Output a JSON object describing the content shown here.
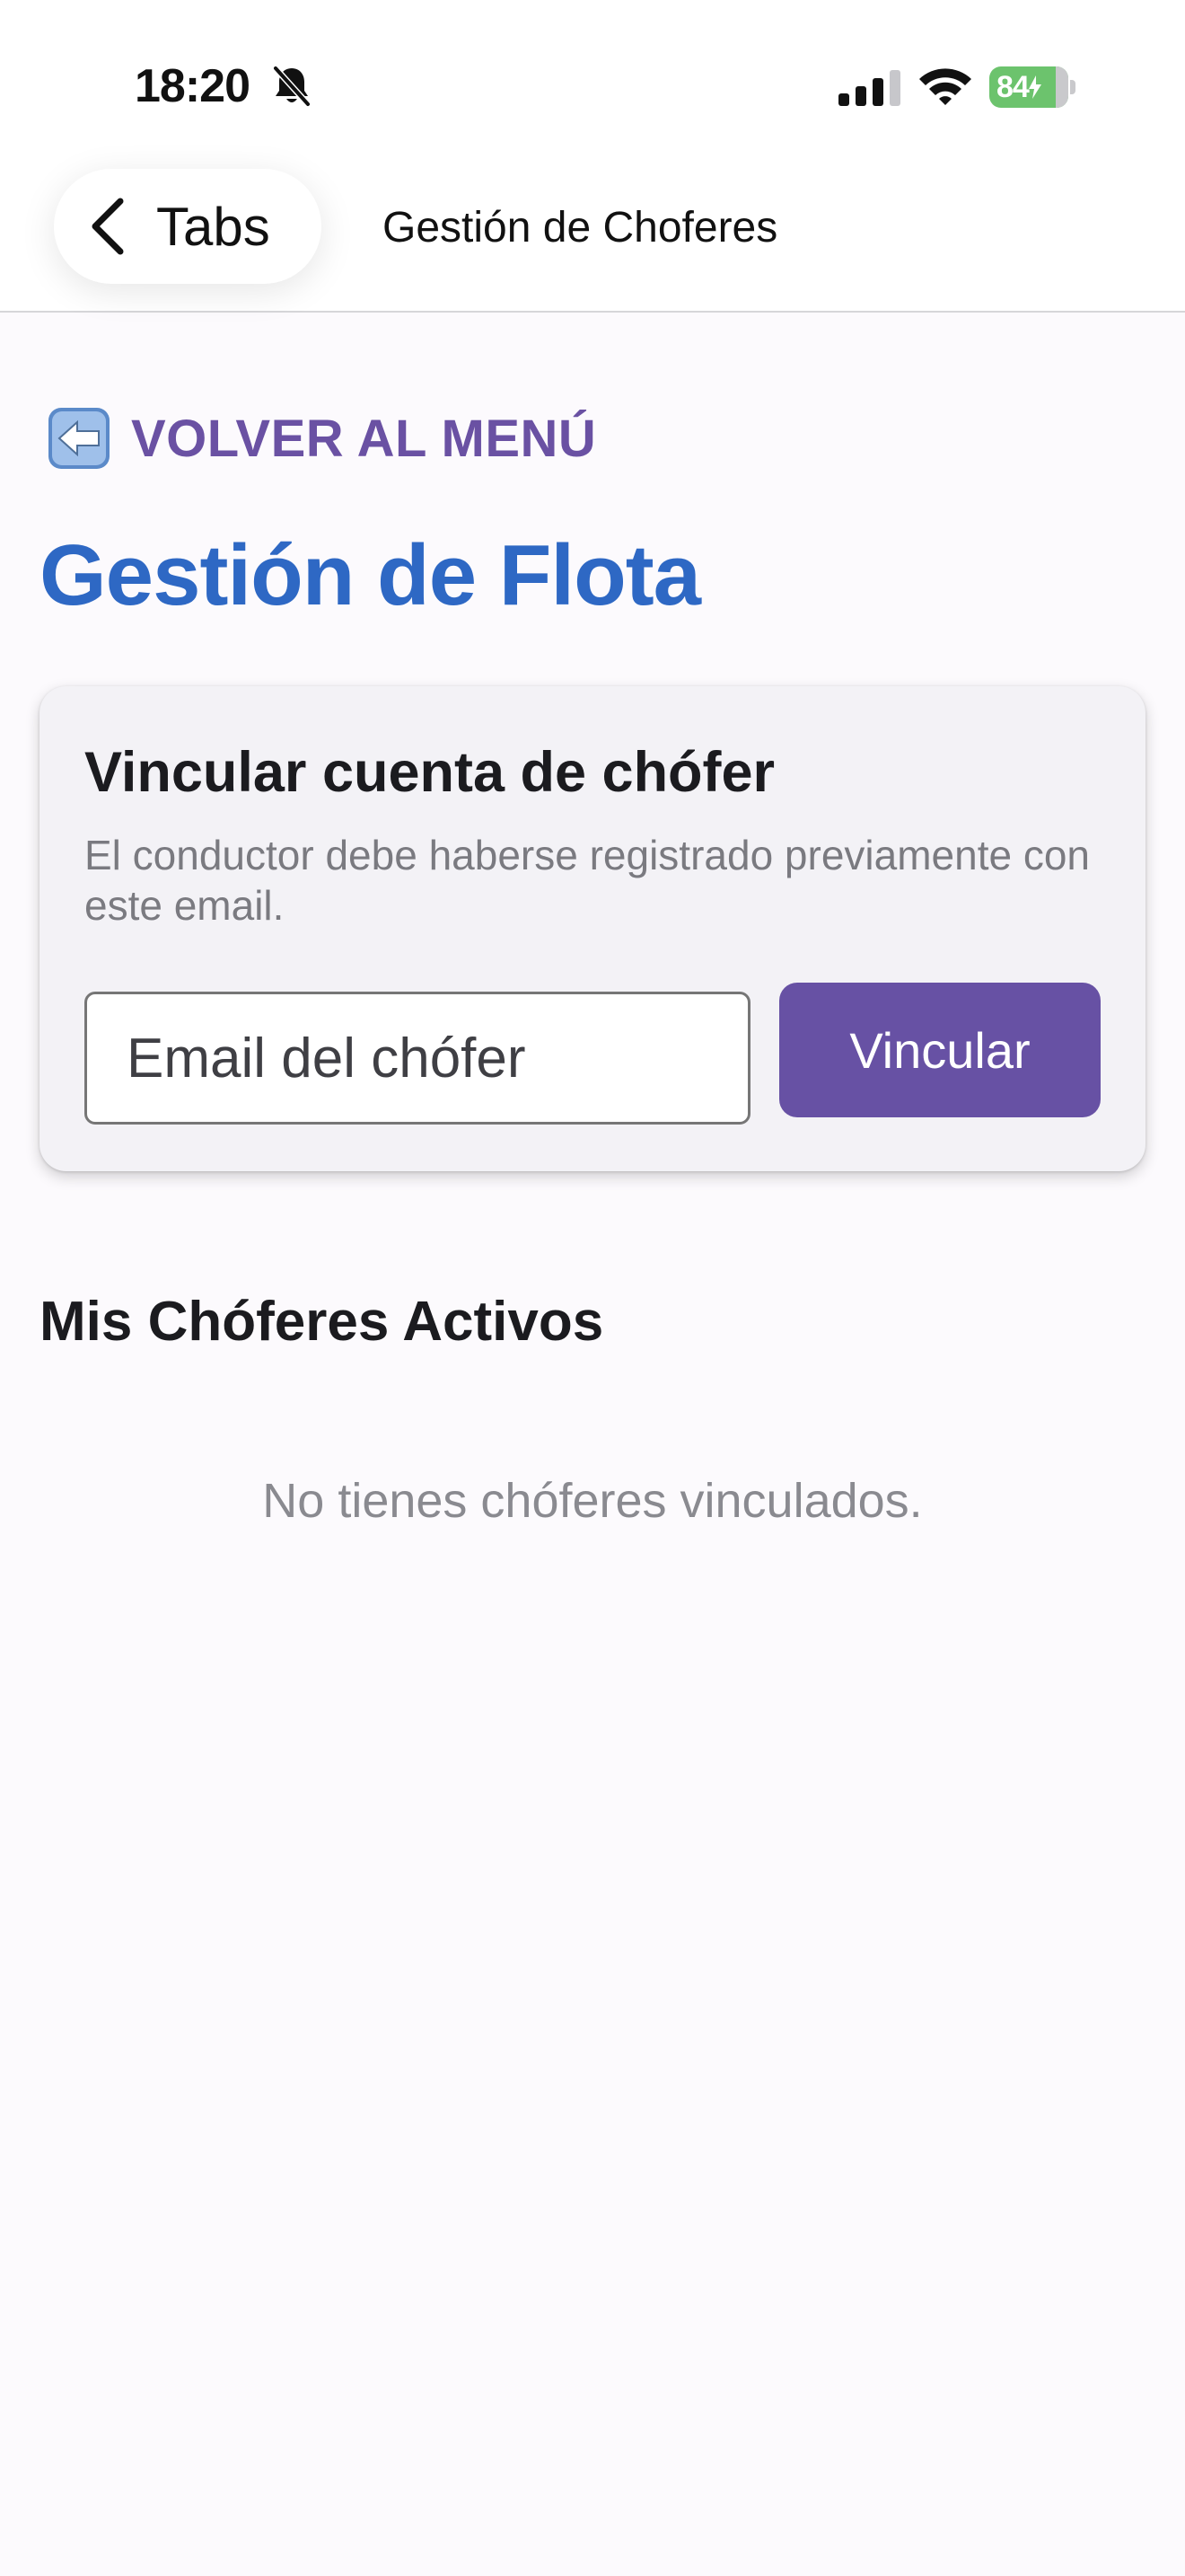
{
  "status_bar": {
    "time": "18:20",
    "battery_level": "84",
    "battery_color": "#6cc36d",
    "icons": [
      "bell-slash-icon",
      "signal-icon",
      "wifi-icon",
      "battery-charging-icon"
    ]
  },
  "nav": {
    "back_label": "Tabs",
    "back_icon": "chevron-left-icon",
    "title": "Gestión de Choferes"
  },
  "content": {
    "back_link_icon": "left-arrow-emoji-icon",
    "back_link_label": "VOLVER AL MENÚ",
    "page_title": "Gestión de Flota",
    "link_card": {
      "title": "Vincular cuenta de chófer",
      "description": "El conductor debe haberse registrado previamente con este email.",
      "email_placeholder": "Email del chófer",
      "email_value": "",
      "button_label": "Vincular"
    },
    "drivers_section_title": "Mis Chóferes Activos",
    "empty_message": "No tienes chóferes vinculados."
  },
  "colors": {
    "accent_purple": "#6751a4",
    "title_blue": "#2e68c4",
    "background": "#fcfafd",
    "card_background": "#f3f2f6"
  }
}
